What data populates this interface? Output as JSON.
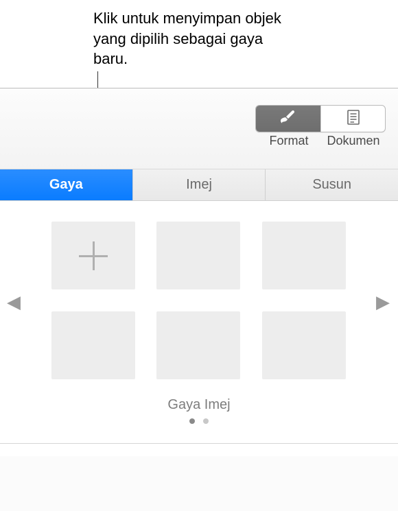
{
  "callout": {
    "text": "Klik untuk menyimpan objek yang dipilih sebagai gaya baru."
  },
  "toolbar": {
    "format_label": "Format",
    "document_label": "Dokumen"
  },
  "tabs": {
    "style": "Gaya",
    "image": "Imej",
    "arrange": "Susun"
  },
  "styles": {
    "caption": "Gaya Imej",
    "pages": 2,
    "active_page": 0
  },
  "icons": {
    "brush": "format-brush-icon",
    "document": "document-icon",
    "plus": "add-style-icon",
    "chevron_left": "chevron-left-icon",
    "chevron_right": "chevron-right-icon"
  }
}
